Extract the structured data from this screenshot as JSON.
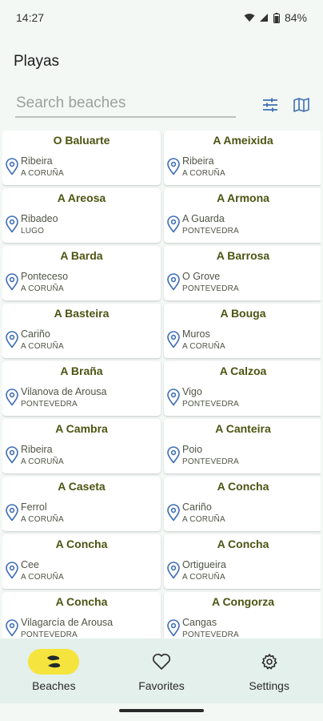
{
  "status": {
    "time": "14:27",
    "battery": "84%"
  },
  "app": {
    "title": "Playas"
  },
  "search": {
    "placeholder": "Search beaches",
    "value": ""
  },
  "beaches": [
    {
      "name": "O Baluarte",
      "town": "Ribeira",
      "province": "A CORUÑA"
    },
    {
      "name": "A Ameixida",
      "town": "Ribeira",
      "province": "A CORUÑA"
    },
    {
      "name": "A Areosa",
      "town": "Ribadeo",
      "province": "LUGO"
    },
    {
      "name": "A Armona",
      "town": "A Guarda",
      "province": "PONTEVEDRA"
    },
    {
      "name": "A Barda",
      "town": "Ponteceso",
      "province": "A CORUÑA"
    },
    {
      "name": "A Barrosa",
      "town": "O Grove",
      "province": "PONTEVEDRA"
    },
    {
      "name": "A Basteira",
      "town": "Cariño",
      "province": "A CORUÑA"
    },
    {
      "name": "A Bouga",
      "town": "Muros",
      "province": "A CORUÑA"
    },
    {
      "name": "A Braña",
      "town": "Vilanova de Arousa",
      "province": "PONTEVEDRA"
    },
    {
      "name": "A Calzoa",
      "town": "Vigo",
      "province": "PONTEVEDRA"
    },
    {
      "name": "A Cambra",
      "town": "Ribeira",
      "province": "A CORUÑA"
    },
    {
      "name": "A Canteira",
      "town": "Poio",
      "province": "PONTEVEDRA"
    },
    {
      "name": "A Caseta",
      "town": "Ferrol",
      "province": "A CORUÑA"
    },
    {
      "name": "A Concha",
      "town": "Cariño",
      "province": "A CORUÑA"
    },
    {
      "name": "A Concha",
      "town": "Cee",
      "province": "A CORUÑA"
    },
    {
      "name": "A Concha",
      "town": "Ortigueira",
      "province": "A CORUÑA"
    },
    {
      "name": "A Concha",
      "town": "Vilagarcía de Arousa",
      "province": "PONTEVEDRA"
    },
    {
      "name": "A Congorza",
      "town": "Cangas",
      "province": "PONTEVEDRA"
    }
  ],
  "nav": {
    "items": [
      {
        "label": "Beaches",
        "icon": "beach-icon",
        "active": true
      },
      {
        "label": "Favorites",
        "icon": "heart-icon",
        "active": false
      },
      {
        "label": "Settings",
        "icon": "gear-icon",
        "active": false
      }
    ]
  },
  "colors": {
    "accent": "#f5e43e",
    "title": "#4d5412",
    "pin": "#3f6fb5"
  }
}
